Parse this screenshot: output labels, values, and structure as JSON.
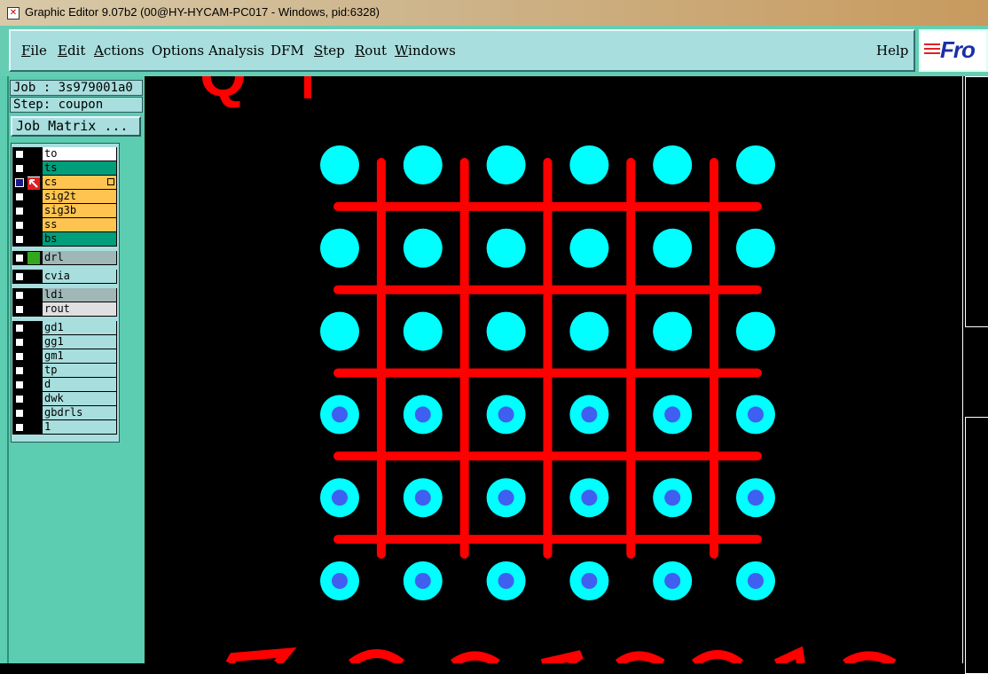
{
  "window": {
    "title": "Graphic Editor 9.07b2 (00@HY-HYCAM-PC017 - Windows, pid:6328)"
  },
  "menubar": {
    "items": [
      "File",
      "Edit",
      "Actions",
      "Options",
      "Analysis",
      "DFM",
      "Step",
      "Rout",
      "Windows"
    ],
    "help": "Help"
  },
  "logo": {
    "text": "Fro"
  },
  "job": {
    "label": "Job : 3s979001a0",
    "step": "Step: coupon",
    "matrix_button": "Job Matrix ..."
  },
  "layers": [
    {
      "name": "to",
      "bg": "#ffffff",
      "color": "#000000"
    },
    {
      "name": "ts",
      "bg": "#009e7a",
      "color": "#000000"
    },
    {
      "name": "cs",
      "bg": "#ffc44f",
      "color": "#000000",
      "selected": true
    },
    {
      "name": "sig2t",
      "bg": "#ffc44f",
      "color": "#000000"
    },
    {
      "name": "sig3b",
      "bg": "#ffc44f",
      "color": "#000000"
    },
    {
      "name": "ss",
      "bg": "#ffc44f",
      "color": "#000000"
    },
    {
      "name": "bs",
      "bg": "#009e7a",
      "color": "#000000"
    },
    {
      "name": "drl",
      "bg": "#9fb7b7",
      "color": "#34a71f"
    },
    {
      "name": "cvia",
      "bg": "#a8dede",
      "color": "#000000"
    },
    {
      "name": "ldi",
      "bg": "#9fb7b7",
      "color": "#000000"
    },
    {
      "name": "rout",
      "bg": "#e0e0e0",
      "color": "#000000"
    },
    {
      "name": "gd1",
      "bg": "#a8dede",
      "color": "#000000"
    },
    {
      "name": "gg1",
      "bg": "#a8dede",
      "color": "#000000"
    },
    {
      "name": "gm1",
      "bg": "#a8dede",
      "color": "#000000"
    },
    {
      "name": "tp",
      "bg": "#a8dede",
      "color": "#000000"
    },
    {
      "name": "d",
      "bg": "#a8dede",
      "color": "#000000"
    },
    {
      "name": "dwk",
      "bg": "#a8dede",
      "color": "#000000"
    },
    {
      "name": "gbdrls",
      "bg": "#a8dede",
      "color": "#000000"
    },
    {
      "name": "1",
      "bg": "#a8dede",
      "color": "#000000"
    }
  ],
  "canvas": {
    "pad_color": "#00ffff",
    "drill_color": "#3f5ff0",
    "trace_color": "#ff0000",
    "grid_cols": 6,
    "grid_rows": 6,
    "drilled_rows_from": 3
  },
  "colors": {
    "panel": "#5ccdb0",
    "menu_bg": "#a8dede",
    "selected_cb": "#1a1a8c"
  }
}
